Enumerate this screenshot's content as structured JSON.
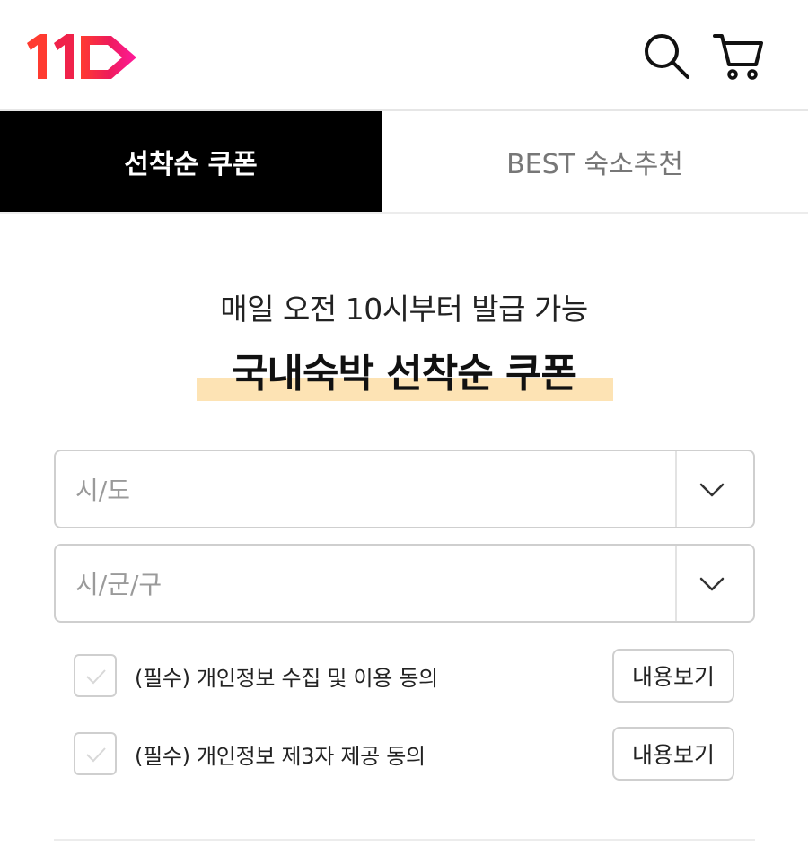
{
  "header": {
    "logo_icon": "11st-logo",
    "search_icon": "search-icon",
    "cart_icon": "cart-icon",
    "brand_colors": [
      "#ff2a2a",
      "#e6007e",
      "#ff1a8c"
    ]
  },
  "tabs": [
    {
      "label": "선착순 쿠폰",
      "active": true
    },
    {
      "label": "BEST 숙소추천",
      "active": false
    }
  ],
  "promo": {
    "subtitle": "매일 오전 10시부터 발급 가능",
    "title": "국내숙박 선착순 쿠폰",
    "highlight_color": "#fde3b4"
  },
  "selects": [
    {
      "placeholder": "시/도"
    },
    {
      "placeholder": "시/군/구"
    }
  ],
  "agreements": [
    {
      "label": "(필수) 개인정보 수집 및 이용 동의",
      "button": "내용보기",
      "checked": false
    },
    {
      "label": "(필수) 개인정보 제3자 제공 동의",
      "button": "내용보기",
      "checked": false
    }
  ]
}
